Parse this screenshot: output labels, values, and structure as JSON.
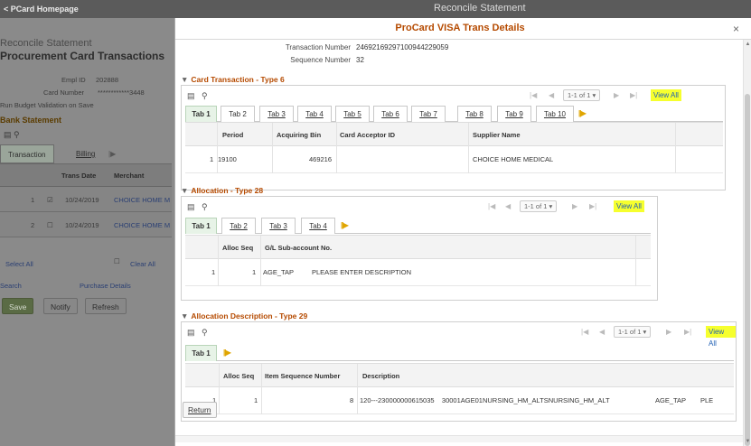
{
  "background": {
    "back_label": "< PCard Homepage",
    "center_title": "Reconcile Statement",
    "subtitle": "Reconcile Statement",
    "title": "Procurement Card Transactions",
    "empl_id_label": "Empl ID",
    "empl_id_value": "202888",
    "card_number_label": "Card Number",
    "card_number_value": "************3448",
    "budget_label": "Run Budget Validation on Save",
    "section": "Bank Statement",
    "tabs": [
      "Transaction",
      "Billing"
    ],
    "columns": [
      "Trans Date",
      "Merchant"
    ],
    "rows": [
      {
        "num": "1",
        "date": "10/24/2019",
        "merchant": "CHOICE HOME M"
      },
      {
        "num": "2",
        "date": "10/24/2019",
        "merchant": "CHOICE HOME M"
      }
    ],
    "select_all": "Select All",
    "clear_all": "Clear All",
    "search": "Search",
    "purchase_details": "Purchase Details",
    "buttons": {
      "save": "Save",
      "notify": "Notify",
      "refresh": "Refresh"
    }
  },
  "modal": {
    "title": "ProCard VISA Trans Details",
    "close": "×",
    "transaction_number_label": "Transaction Number",
    "transaction_number_value": "24692169297100944229059",
    "sequence_number_label": "Sequence Number",
    "sequence_number_value": "32",
    "card_transaction": {
      "title": "Card Transaction - Type 6",
      "pager": "1-1 of 1",
      "view_all": "View All",
      "tabs": [
        "Tab 1",
        "Tab 2",
        "Tab 3",
        "Tab 4",
        "Tab 5",
        "Tab 6",
        "Tab 7",
        "Tab 8",
        "Tab 9",
        "Tab 10"
      ],
      "columns": [
        "Period",
        "Acquiring Bin",
        "Card Acceptor ID",
        "Supplier Name"
      ],
      "rows": [
        {
          "num": "1",
          "period": "19100",
          "bin": "469216",
          "acceptor": "",
          "supplier": "CHOICE HOME MEDICAL"
        }
      ]
    },
    "allocation": {
      "title": "Allocation - Type 28",
      "pager": "1-1 of 1",
      "view_all": "View All",
      "tabs": [
        "Tab 1",
        "Tab 2",
        "Tab 3",
        "Tab 4"
      ],
      "columns": [
        "Alloc Seq",
        "G/L Sub-account No."
      ],
      "rows": [
        {
          "num": "1",
          "alloc_seq": "1",
          "subaccount": "AGE_TAP",
          "desc": "PLEASE ENTER DESCRIPTION"
        }
      ]
    },
    "allocation_description": {
      "title": "Allocation Description - Type 29",
      "pager": "1-1 of 1",
      "view_all": "View All",
      "tabs": [
        "Tab 1"
      ],
      "columns": [
        "Alloc Seq",
        "Item Sequence Number",
        "Description"
      ],
      "rows": [
        {
          "num": "1",
          "alloc_seq": "1",
          "item_seq": "8",
          "description": "120---230000000615035    30001AGE01NURSING_HM_ALTSNURSING_HM_ALT",
          "c1": "AGE_TAP",
          "c2": "PLE"
        }
      ]
    },
    "return_label": "Return"
  }
}
